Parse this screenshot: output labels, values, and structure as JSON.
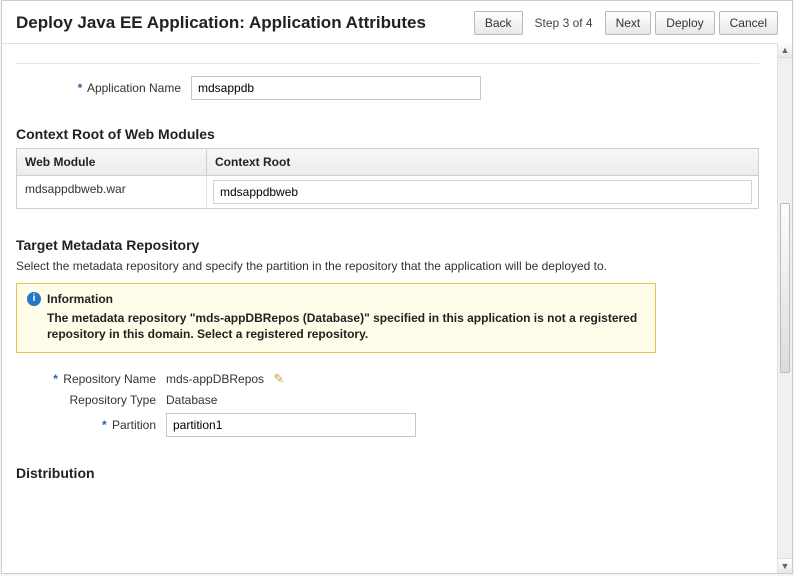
{
  "header": {
    "title": "Deploy Java EE Application: Application Attributes",
    "back": "Back",
    "step": "Step 3 of 4",
    "next": "Next",
    "deploy": "Deploy",
    "cancel": "Cancel"
  },
  "appName": {
    "label": "Application Name",
    "value": "mdsappdb"
  },
  "contextRoot": {
    "heading": "Context Root of Web Modules",
    "colWebModule": "Web Module",
    "colContextRoot": "Context Root",
    "rows": [
      {
        "module": "mdsappdbweb.war",
        "root": "mdsappdbweb"
      }
    ]
  },
  "targetRepo": {
    "heading": "Target Metadata Repository",
    "description": "Select the metadata repository and specify the partition in the repository that the application will be deployed to.",
    "info": {
      "title": "Information",
      "body": "The metadata repository \"mds-appDBRepos (Database)\" specified in this application is not a registered repository in this domain. Select a registered repository."
    },
    "repoNameLabel": "Repository Name",
    "repoNameValue": "mds-appDBRepos",
    "repoTypeLabel": "Repository Type",
    "repoTypeValue": "Database",
    "partitionLabel": "Partition",
    "partitionValue": "partition1"
  },
  "distribution": {
    "heading": "Distribution"
  }
}
